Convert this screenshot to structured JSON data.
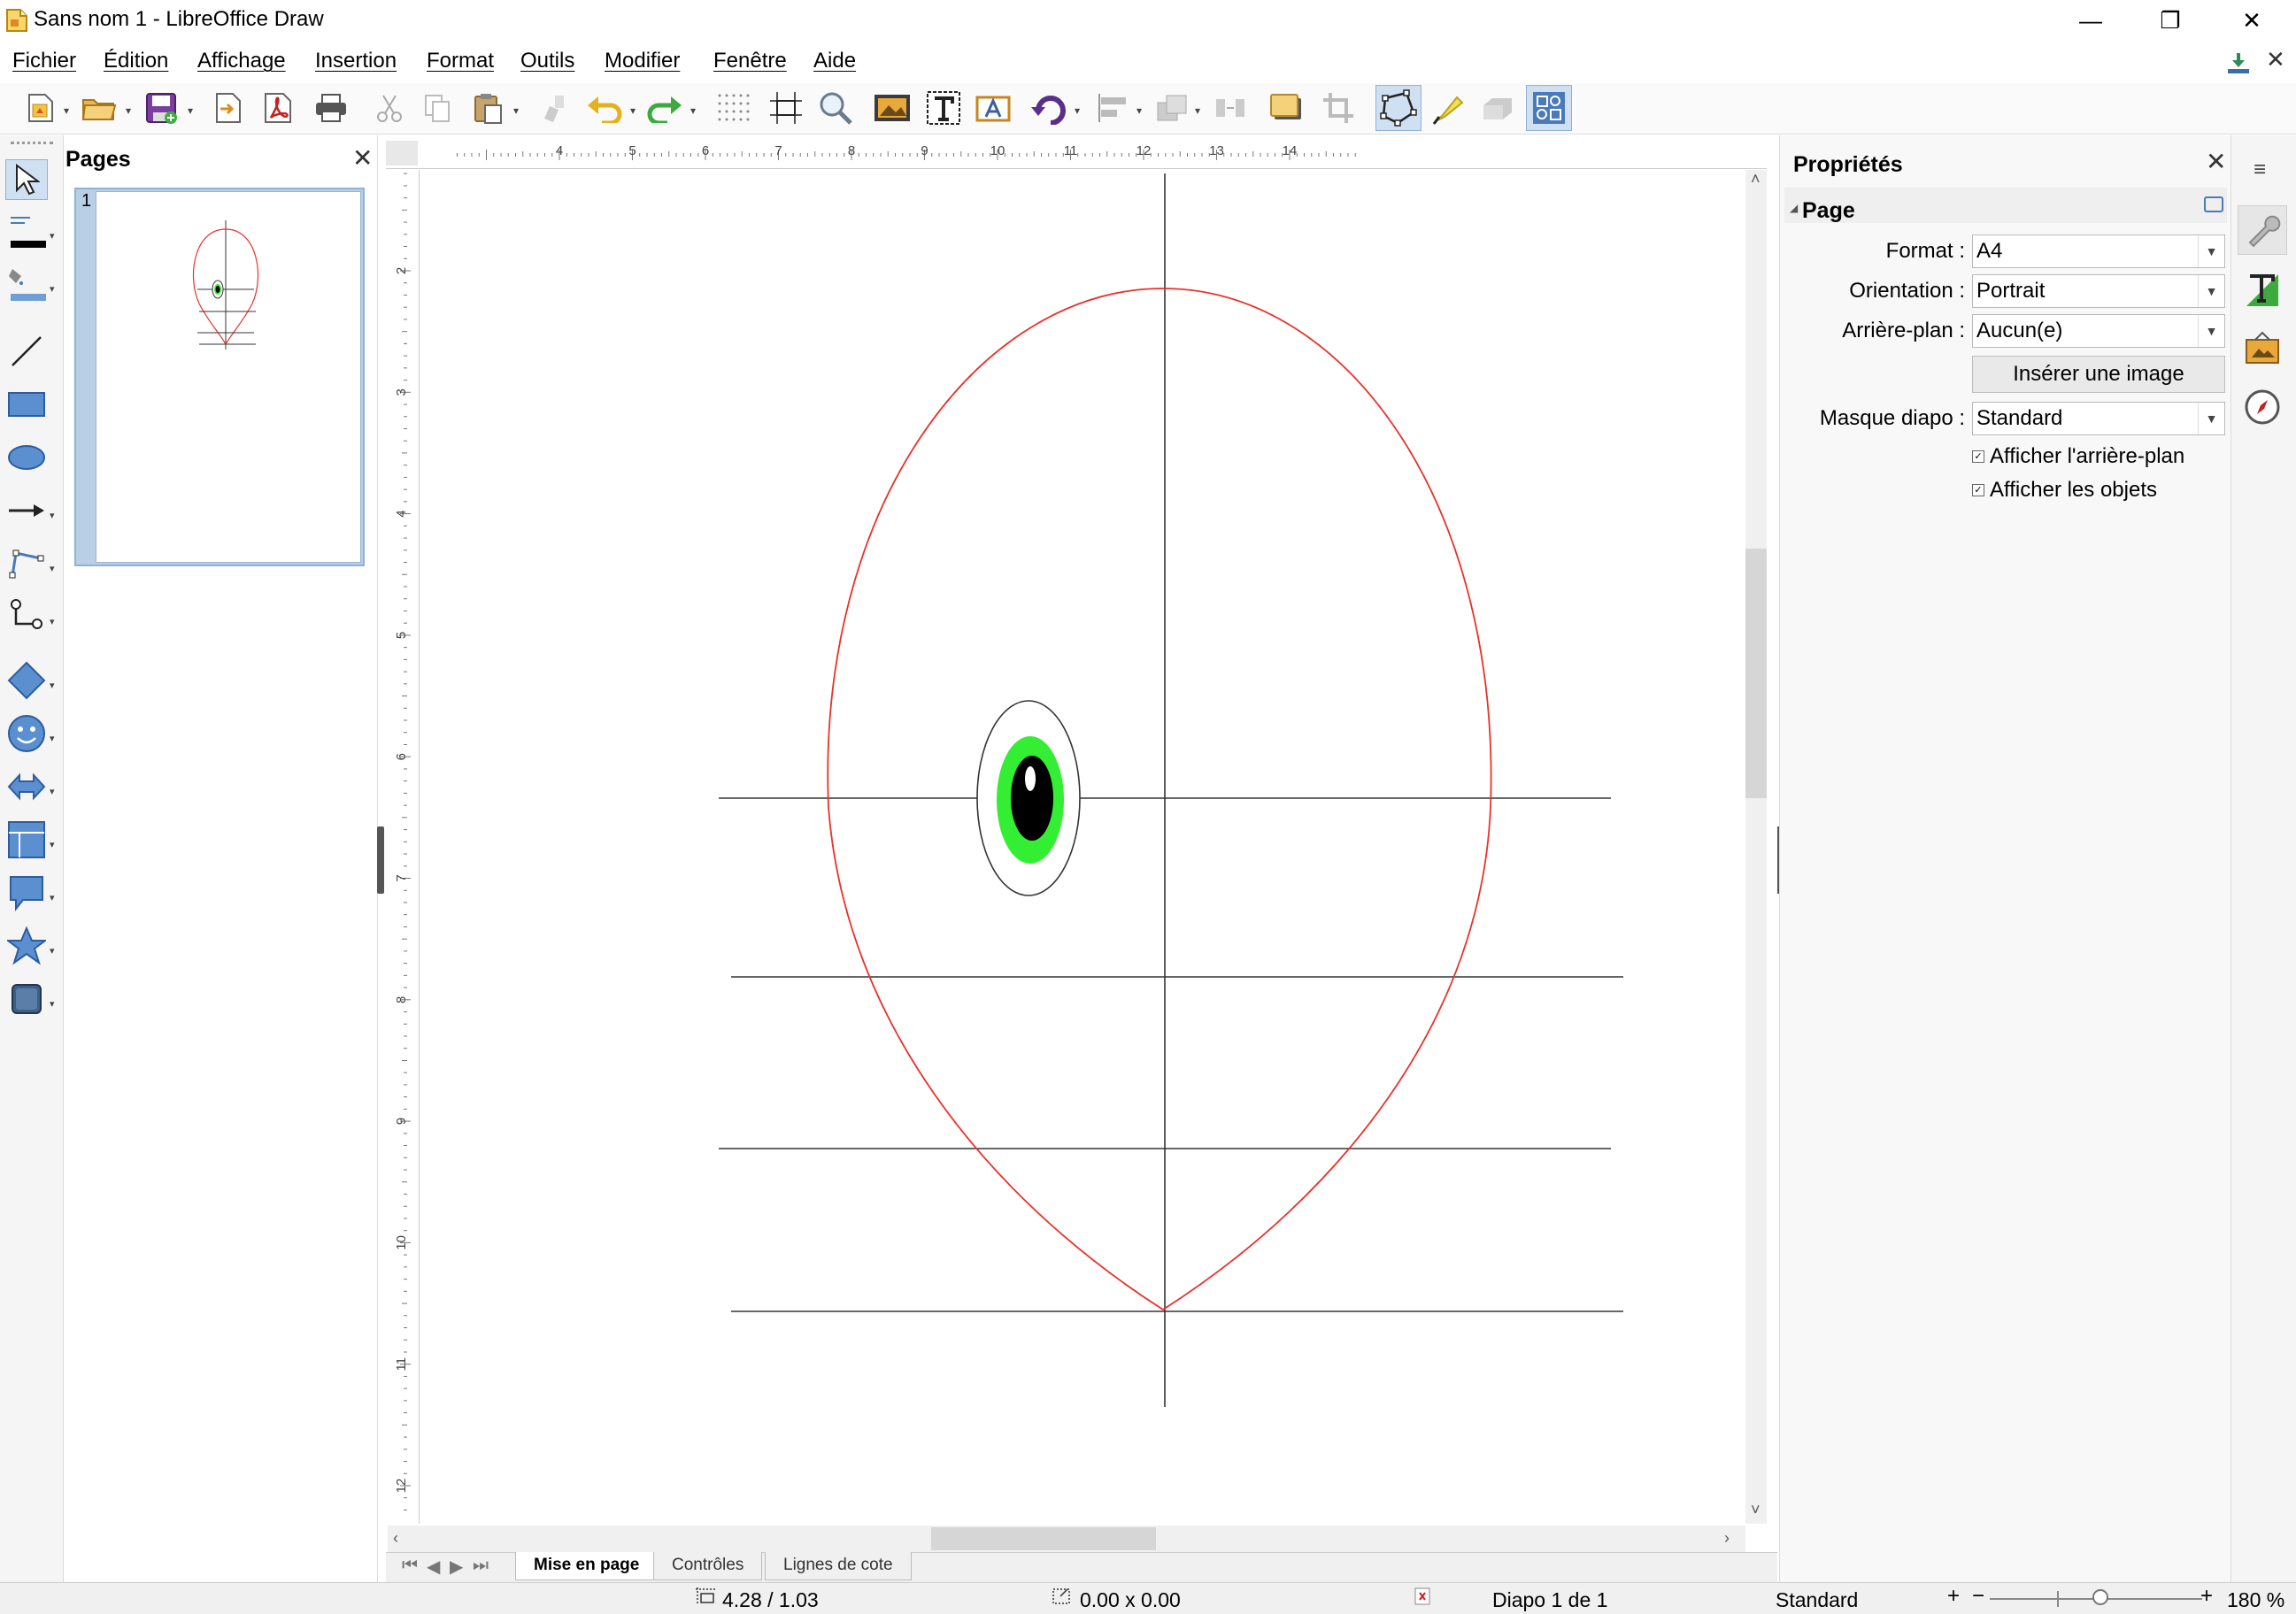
{
  "window": {
    "title": "Sans nom 1 - LibreOffice Draw",
    "minimize_glyph": "—",
    "restore_glyph": "❐",
    "close_glyph": "✕"
  },
  "menu": {
    "items": [
      "Fichier",
      "Édition",
      "Affichage",
      "Insertion",
      "Format",
      "Outils",
      "Modifier",
      "Fenêtre",
      "Aide"
    ],
    "close_glyph": "✕"
  },
  "pages_panel": {
    "title": "Pages",
    "close_glyph": "✕",
    "pages": [
      {
        "number": "1"
      }
    ]
  },
  "document_tabs": {
    "nav_glyphs": [
      "⏮",
      "◀",
      "▶",
      "⏭"
    ],
    "tabs": [
      "Mise en page",
      "Contrôles",
      "Lignes de cote"
    ],
    "active_index": 0
  },
  "rulers": {
    "horizontal_ticks": [
      "4",
      "5",
      "6",
      "7",
      "8",
      "9",
      "10",
      "11",
      "12",
      "13",
      "14"
    ],
    "vertical_ticks": [
      "2",
      "3",
      "4",
      "5",
      "6",
      "7",
      "8",
      "9",
      "10",
      "11",
      "12"
    ]
  },
  "statusbar": {
    "position": "4.28 / 1.03",
    "size": "0.00 x 0.00",
    "slide": "Diapo 1 de 1",
    "master": "Standard",
    "zoom": "180 %",
    "zoom_minus": "−",
    "zoom_plus": "+"
  },
  "properties": {
    "title": "Propriétés",
    "close_glyph": "✕",
    "section_title": "Page",
    "format_label": "Format :",
    "format_value": "A4",
    "orientation_label": "Orientation :",
    "orientation_value": "Portrait",
    "background_label": "Arrière-plan :",
    "background_value": "Aucun(e)",
    "insert_image_label": "Insérer une image",
    "master_label": "Masque diapo :",
    "master_value": "Standard",
    "show_background_label": "Afficher l'arrière-plan",
    "show_background_checked": true,
    "show_objects_label": "Afficher les objets",
    "show_objects_checked": true
  },
  "colors": {
    "egg_outline": "#e8322a",
    "iris": "#33ee33",
    "pupil": "#000000",
    "guide_lines": "#333333",
    "selected_tool": "#cfe0f3"
  },
  "toolbar_icons": [
    "new-document-icon",
    "open-icon",
    "save-icon",
    "export-icon",
    "export-pdf-icon",
    "print-icon",
    "cut-icon",
    "copy-icon",
    "paste-icon",
    "clone-formatting-icon",
    "undo-icon",
    "redo-icon",
    "grid-icon",
    "helplines-icon",
    "zoom-icon",
    "image-icon",
    "text-box-icon",
    "fontwork-icon",
    "rotate-icon",
    "align-icon",
    "arrange-icon",
    "distribute-icon",
    "shadow-icon",
    "crop-icon",
    "points-icon",
    "glue-points-icon",
    "toggle-extrusion-icon",
    "select-at-frames-icon"
  ],
  "left_toolbar_icons": [
    "select-icon",
    "line-color-icon",
    "fill-color-icon",
    "line-icon",
    "rectangle-icon",
    "ellipse-icon",
    "arrow-line-icon",
    "curve-icon",
    "connector-icon",
    "basic-shapes-icon",
    "symbol-shapes-icon",
    "block-arrows-icon",
    "flowchart-icon",
    "callouts-icon",
    "stars-icon",
    "3d-objects-icon"
  ],
  "deck_icons": [
    "properties-deck-icon",
    "styles-deck-icon",
    "gallery-deck-icon",
    "navigator-deck-icon"
  ]
}
